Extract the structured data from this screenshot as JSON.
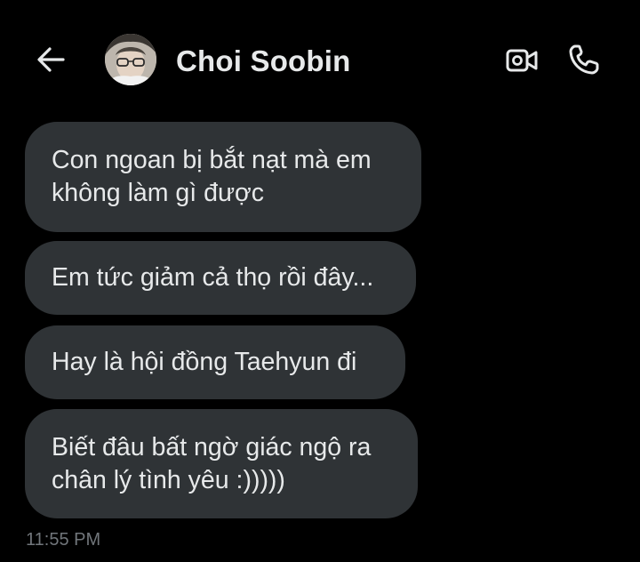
{
  "header": {
    "contact_name": "Choi Soobin",
    "back_icon": "arrow-left-icon",
    "video_icon": "video-camera-icon",
    "call_icon": "phone-icon"
  },
  "messages": [
    {
      "text": "Con ngoan bị bắt nạt mà em\nkhông làm gì được"
    },
    {
      "text": "Em tức giảm cả thọ rồi đây..."
    },
    {
      "text": "Hay là hội đồng Taehyun đi"
    },
    {
      "text": "Biết đâu bất ngờ giác ngộ ra\nchân lý tình yêu :)))))"
    }
  ],
  "timestamp": "11:55 PM",
  "colors": {
    "background": "#000000",
    "bubble": "#2f3336",
    "text": "#e7e9ea",
    "muted": "#71767b"
  }
}
